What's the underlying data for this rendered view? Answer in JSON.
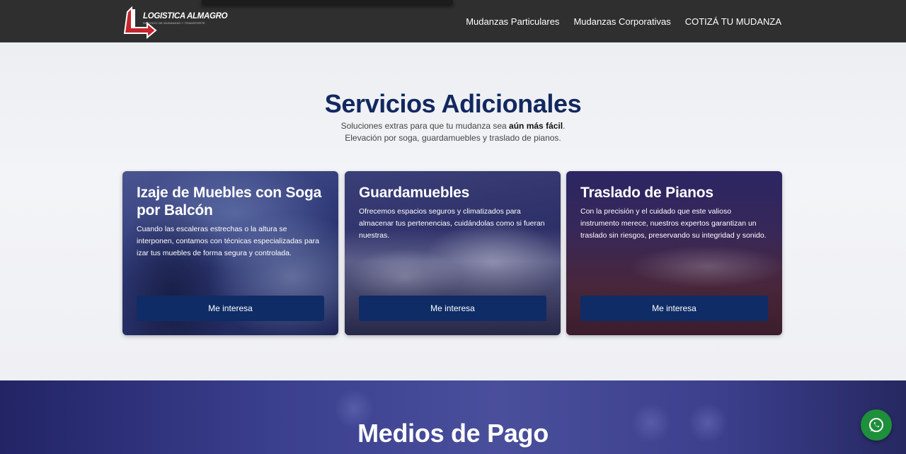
{
  "brand": {
    "name": "LOGISTICA ALMAGRO",
    "tagline": "SERVICIO DE MUDANZAS Y TRANSPORTE"
  },
  "nav": {
    "items": [
      {
        "label": "Mudanzas Particulares"
      },
      {
        "label": "Mudanzas Corporativas"
      },
      {
        "label": "COTIZÁ TU MUDANZA"
      }
    ]
  },
  "services": {
    "title": "Servicios Adicionales",
    "subtitle_pre": "Soluciones extras para que tu mudanza sea ",
    "subtitle_bold": "aún más fácil",
    "subtitle_post": ".",
    "subtitle_line2": "Elevación por soga, guardamuebles y traslado de pianos.",
    "cards": [
      {
        "title": "Izaje de Muebles con Soga por Balcón",
        "text": "Cuando las escaleras estrechas o la altura se interponen, contamos con técnicas especializadas para izar tus muebles de forma segura y controlada.",
        "button": "Me interesa"
      },
      {
        "title": "Guardamuebles",
        "text": "Ofrecemos espacios seguros y climatizados para almacenar tus pertenencias, cuidándolas como si fueran nuestras.",
        "button": "Me interesa"
      },
      {
        "title": "Traslado de Pianos",
        "text": "Con la precisión y el cuidado que este valioso instrumento merece, nuestros expertos garantizan un traslado sin riesgos, preservando su integridad y sonido.",
        "button": "Me interesa"
      }
    ]
  },
  "payments": {
    "title": "Medios de Pago"
  },
  "whatsapp": {
    "icon": "whatsapp-icon",
    "color": "#1e8f3a"
  },
  "colors": {
    "accent": "#12285f",
    "button": "#0f2c66",
    "header": "#2f2f2f"
  }
}
